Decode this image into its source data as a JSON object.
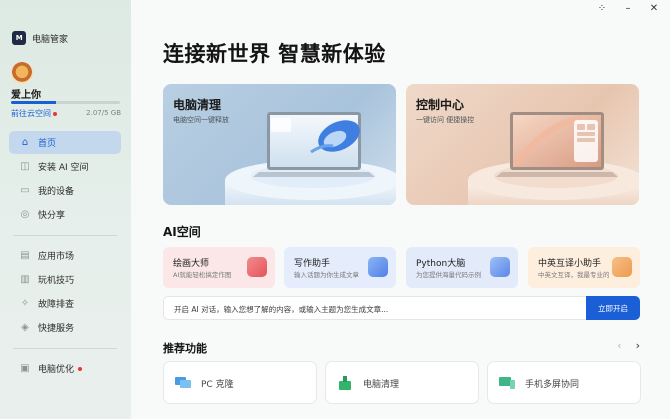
{
  "app": {
    "name": "电脑管家",
    "logo_text": "M"
  },
  "window_controls": [
    "scan-icon",
    "minimize-icon",
    "close-icon"
  ],
  "user": {
    "name": "爱上你",
    "cloud_link": "前往云空间",
    "storage_used": 2.07,
    "storage_total": 5,
    "storage_text": "2.07/5 GB"
  },
  "sidebar": {
    "items": [
      {
        "label": "首页",
        "icon": "home-icon",
        "glyph": "⌂",
        "active": true
      },
      {
        "label": "安装 AI 空间",
        "icon": "ai-space-icon",
        "glyph": "◫"
      },
      {
        "label": "我的设备",
        "icon": "devices-icon",
        "glyph": "▭"
      },
      {
        "label": "快分享",
        "icon": "share-icon",
        "glyph": "◎"
      }
    ],
    "items2": [
      {
        "label": "应用市场",
        "icon": "app-market-icon",
        "glyph": "▤"
      },
      {
        "label": "玩机技巧",
        "icon": "tips-icon",
        "glyph": "▥"
      },
      {
        "label": "故障排查",
        "icon": "troubleshoot-icon",
        "glyph": "✧"
      },
      {
        "label": "快捷服务",
        "icon": "service-icon",
        "glyph": "◈"
      }
    ],
    "items3": [
      {
        "label": "电脑优化",
        "icon": "optimize-icon",
        "glyph": "▣"
      }
    ]
  },
  "main": {
    "headline": "连接新世界 智慧新体验",
    "hero_cards": [
      {
        "title": "电脑清理",
        "subtitle": "电脑空间一键释放"
      },
      {
        "title": "控制中心",
        "subtitle": "一键访问 便捷操控"
      }
    ],
    "ai_section": {
      "title": "AI空间",
      "cards": [
        {
          "title": "绘画大师",
          "desc": "AI就能轻松搞定作图",
          "icon": "paint-icon"
        },
        {
          "title": "写作助手",
          "desc": "输入话题为你生成文章",
          "icon": "writing-icon"
        },
        {
          "title": "Python大脑",
          "desc": "为您提供海量代码示例",
          "icon": "python-icon"
        },
        {
          "title": "中英互译小助手",
          "desc": "中英文互译，我最专业的",
          "icon": "translate-icon"
        }
      ],
      "prompt_placeholder": "开启 AI 对话，输入您想了解的内容，或输入主题为您生成文章...",
      "prompt_button": "立即开启"
    },
    "recommend": {
      "title": "推荐功能",
      "cards": [
        {
          "label": "PC 克隆",
          "icon": "pc-clone-icon"
        },
        {
          "label": "电脑清理",
          "icon": "cleanup-icon"
        },
        {
          "label": "手机多屏协同",
          "icon": "multiscreen-icon"
        }
      ]
    }
  },
  "colors": {
    "accent": "#1b5fd6",
    "badge": "#e53935"
  }
}
